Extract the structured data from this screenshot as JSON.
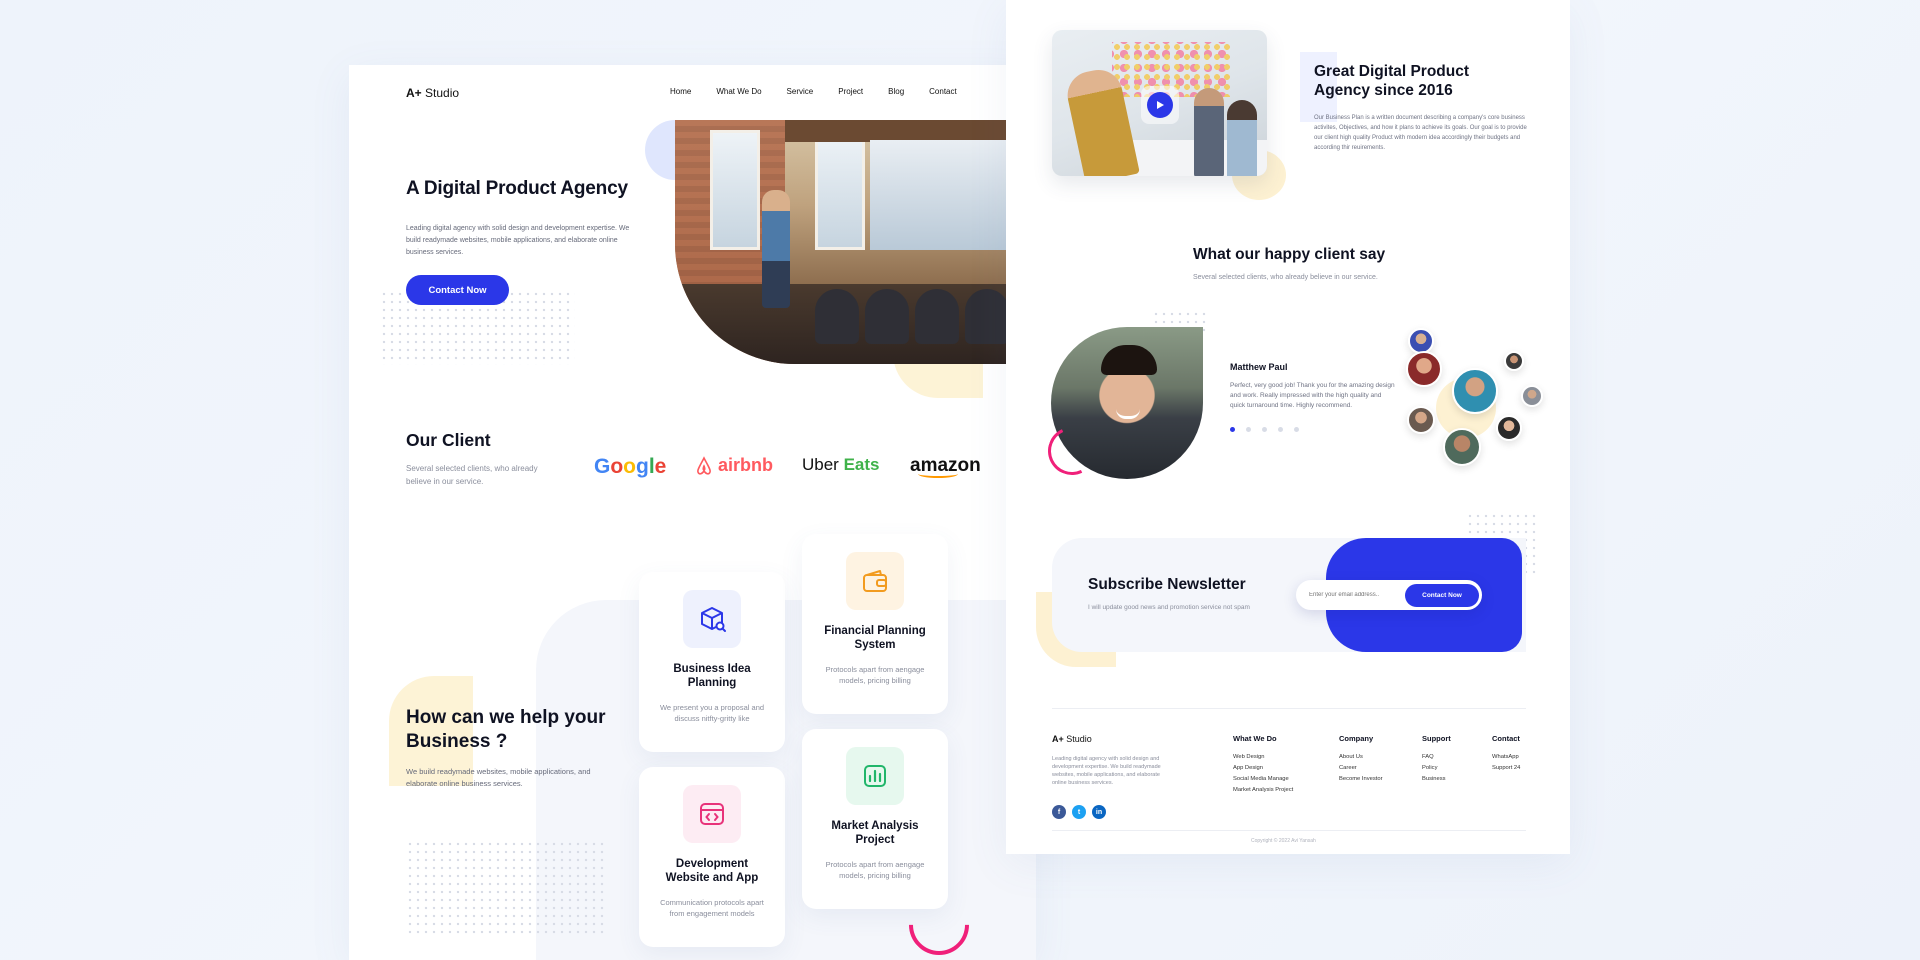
{
  "left": {
    "brand": {
      "mark": "A+",
      "name": " Studio"
    },
    "nav": [
      "Home",
      "What We Do",
      "Service",
      "Project",
      "Blog",
      "Contact"
    ],
    "hero": {
      "title": "A Digital Product Agency",
      "description": "Leading digital agency with solid design and development expertise. We build readymade websites, mobile applications, and elaborate online business services.",
      "cta": "Contact Now"
    },
    "clients": {
      "title": "Our Client",
      "description": "Several selected clients, who already believe in our service.",
      "logos": {
        "google": [
          "G",
          "o",
          "o",
          "g",
          "l",
          "e"
        ],
        "airbnb": "airbnb",
        "uber": "Uber",
        "eats": "Eats",
        "amazon": "amazon"
      }
    },
    "help": {
      "title": "How can we help your Business ?",
      "description": "We build readymade websites, mobile applications, and elaborate online business services."
    },
    "cards": [
      {
        "title": "Business Idea Planning",
        "text": "We present you a proposal and discuss nitfty-gritty like",
        "icon": "box-search-icon",
        "color": "#2b37e8",
        "bg": "#eef1fd"
      },
      {
        "title": "Financial Planning System",
        "text": "Protocols apart from aengage models, pricing billing",
        "icon": "wallet-icon",
        "color": "#f29b1f",
        "bg": "#fef3e2"
      },
      {
        "title": "Development Website and App",
        "text": "Communication protocols apart from engagement models",
        "icon": "code-window-icon",
        "color": "#e8337a",
        "bg": "#fdecf3"
      },
      {
        "title": "Market Analysis Project",
        "text": "Protocols apart from aengage models, pricing billing",
        "icon": "chart-icon",
        "color": "#21b66a",
        "bg": "#e6f8ee"
      }
    ]
  },
  "right": {
    "about": {
      "title": "Great Digital Product Agency since 2016",
      "description": "Our Business Plan is a written document describing a company's core business activites, Objectives, and how it plans to achieve its goals. Our goal is to provide our client high quality Product with modern idea accordingly their budgets and according thir reuirements."
    },
    "testimonials": {
      "title": "What our happy client say",
      "description": "Several selected clients, who already believe in our service.",
      "name": "Matthew Paul",
      "text": "Perfect, very good job! Thank you for the amazing design and work. Really impressed with the high quality and quick turnaround time. Highly recommend.",
      "page_count": 5,
      "active_page": 1
    },
    "newsletter": {
      "title": "Subscribe Newsletter",
      "description": "I will update good news and promotion service not spam",
      "placeholder": "Enter your email address..",
      "button": "Contact Now"
    },
    "footer": {
      "brand": {
        "mark": "A+",
        "name": " Studio"
      },
      "description": "Leading digital agency with solid design and development expertise. We build readymade websites, mobile applications, and elaborate online business services.",
      "social": [
        "f",
        "t",
        "in"
      ],
      "columns": [
        {
          "title": "What We Do",
          "links": [
            "Web Design",
            "App Design",
            "Social Media Manage",
            "Market Analysis Project"
          ]
        },
        {
          "title": "Company",
          "links": [
            "About Us",
            "Career",
            "Become Investor"
          ]
        },
        {
          "title": "Support",
          "links": [
            "FAQ",
            "Policy",
            "Business"
          ]
        },
        {
          "title": "Contact",
          "links": [
            "WhatsApp",
            "Support 24"
          ]
        }
      ],
      "copyright": "Copyright © 2022 Avi Yansah"
    }
  },
  "colors": {
    "accent": "#2b37e8",
    "pink": "#f0207a",
    "yellow": "#fdf3d6"
  }
}
